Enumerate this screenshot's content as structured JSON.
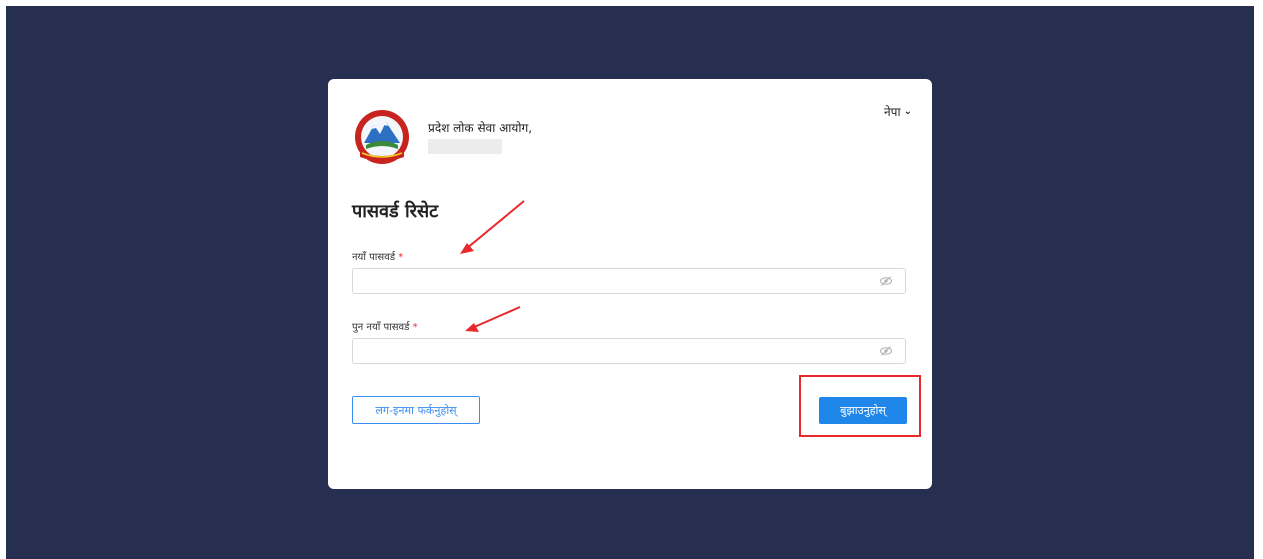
{
  "language_selector": {
    "label": "नेपा",
    "icon": "chevron-down-icon"
  },
  "organization": {
    "name": "प्रदेश लोक सेवा आयोग,",
    "logo_icon": "nepal-emblem-icon"
  },
  "form": {
    "title": "पासवर्ड रिसेट",
    "new_password_label": "नयाँ पासवर्ड",
    "confirm_password_label": "पुन नयाँ पासवर्ड",
    "required_mark": "*",
    "new_password_value": "",
    "confirm_password_value": "",
    "visibility_icon": "eye-slash-icon"
  },
  "actions": {
    "login_label": "लग-इनमा फर्कनुहोस्",
    "submit_label": "बुझाउनुहोस्"
  },
  "colors": {
    "background": "#262f4f",
    "primary": "#1f86ea",
    "required": "#e03030",
    "annotation": "#e8282b"
  }
}
